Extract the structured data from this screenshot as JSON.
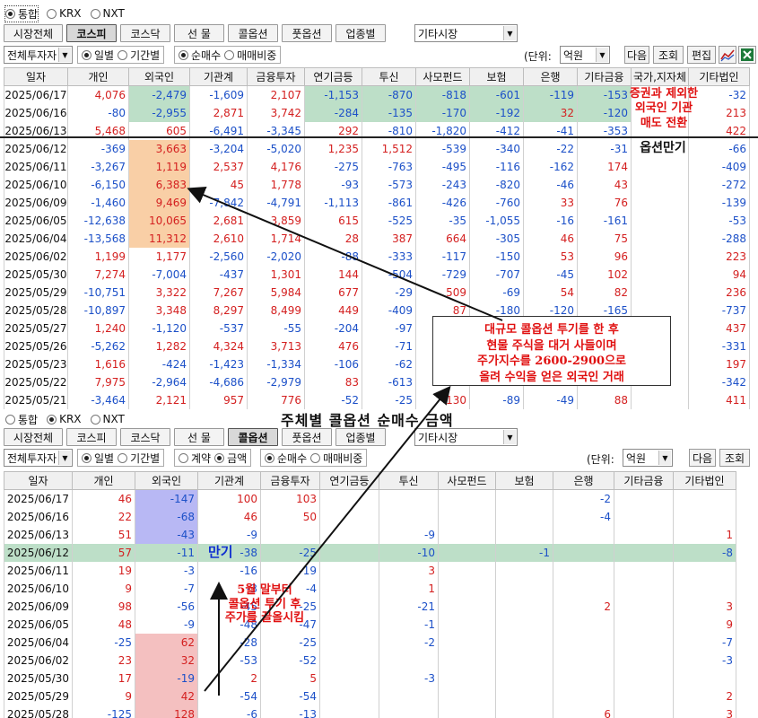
{
  "top": {
    "radios": [
      {
        "label": "통합",
        "checked": true
      },
      {
        "label": "KRX",
        "checked": false
      },
      {
        "label": "NXT",
        "checked": false
      }
    ],
    "tabs": [
      "시장전체",
      "코스피",
      "코스닥",
      "선 물",
      "콜옵션",
      "풋옵션",
      "업종별"
    ],
    "selected_tab": "코스피",
    "market_select": "기타시장",
    "investor_select": "전체투자자",
    "period_options": [
      {
        "label": "일별",
        "checked": true
      },
      {
        "label": "기간별",
        "checked": false
      }
    ],
    "mode_options": [
      {
        "label": "순매수",
        "checked": true
      },
      {
        "label": "매매비중",
        "checked": false
      }
    ],
    "unit_label": "(단위:",
    "unit_select": "억원",
    "buttons": {
      "next": "다음",
      "query": "조회",
      "edit": "편집"
    },
    "icons": [
      "chart-icon",
      "excel-icon"
    ],
    "columns": [
      "일자",
      "개인",
      "외국인",
      "기관계",
      "금융투자",
      "연기금등",
      "투신",
      "사모펀드",
      "보험",
      "은행",
      "기타금융",
      "국가,지자체",
      "기타법인"
    ],
    "rows": [
      [
        "2025/06/17",
        "4,076",
        "-2,479",
        "-1,609",
        "2,107",
        "-1,153",
        "-870",
        "-818",
        "-601",
        "-119",
        "-153",
        "",
        "-32"
      ],
      [
        "2025/06/16",
        "-80",
        "-2,955",
        "2,871",
        "3,742",
        "-284",
        "-135",
        "-170",
        "-192",
        "32",
        "-120",
        "",
        "213"
      ],
      [
        "2025/06/13",
        "5,468",
        "605",
        "-6,491",
        "-3,345",
        "292",
        "-810",
        "-1,820",
        "-412",
        "-41",
        "-353",
        "",
        "422"
      ],
      [
        "2025/06/12",
        "-369",
        "3,663",
        "-3,204",
        "-5,020",
        "1,235",
        "1,512",
        "-539",
        "-340",
        "-22",
        "-31",
        "",
        "-66"
      ],
      [
        "2025/06/11",
        "-3,267",
        "1,119",
        "2,537",
        "4,176",
        "-275",
        "-763",
        "-495",
        "-116",
        "-162",
        "174",
        "",
        "-409"
      ],
      [
        "2025/06/10",
        "-6,150",
        "6,383",
        "45",
        "1,778",
        "-93",
        "-573",
        "-243",
        "-820",
        "-46",
        "43",
        "",
        "-272"
      ],
      [
        "2025/06/09",
        "-1,460",
        "9,469",
        "-7,842",
        "-4,791",
        "-1,113",
        "-861",
        "-426",
        "-760",
        "33",
        "76",
        "",
        "-139"
      ],
      [
        "2025/06/05",
        "-12,638",
        "10,065",
        "2,681",
        "3,859",
        "615",
        "-525",
        "-35",
        "-1,055",
        "-16",
        "-161",
        "",
        "-53"
      ],
      [
        "2025/06/04",
        "-13,568",
        "11,312",
        "2,610",
        "1,714",
        "28",
        "387",
        "664",
        "-305",
        "46",
        "75",
        "",
        "-288"
      ],
      [
        "2025/06/02",
        "1,199",
        "1,177",
        "-2,560",
        "-2,020",
        "-88",
        "-333",
        "-117",
        "-150",
        "53",
        "96",
        "",
        "223"
      ],
      [
        "2025/05/30",
        "7,274",
        "-7,004",
        "-437",
        "1,301",
        "144",
        "-504",
        "-729",
        "-707",
        "-45",
        "102",
        "",
        "94"
      ],
      [
        "2025/05/29",
        "-10,751",
        "3,322",
        "7,267",
        "5,984",
        "677",
        "-29",
        "509",
        "-69",
        "54",
        "82",
        "",
        "236"
      ],
      [
        "2025/05/28",
        "-10,897",
        "3,348",
        "8,297",
        "8,499",
        "449",
        "-409",
        "87",
        "-180",
        "-120",
        "-165",
        "",
        "-737"
      ],
      [
        "2025/05/27",
        "1,240",
        "-1,120",
        "-537",
        "-55",
        "-204",
        "-97",
        "",
        "",
        "",
        "",
        "",
        "437"
      ],
      [
        "2025/05/26",
        "-5,262",
        "1,282",
        "4,324",
        "3,713",
        "476",
        "-71",
        "",
        "",
        "",
        "",
        "",
        "-331"
      ],
      [
        "2025/05/23",
        "1,616",
        "-424",
        "-1,423",
        "-1,334",
        "-106",
        "-62",
        "",
        "",
        "",
        "",
        "",
        "197"
      ],
      [
        "2025/05/22",
        "7,975",
        "-2,964",
        "-4,686",
        "-2,979",
        "83",
        "-613",
        "",
        "",
        "",
        "",
        "",
        "-342"
      ],
      [
        "2025/05/21",
        "-3,464",
        "2,121",
        "957",
        "776",
        "-52",
        "-25",
        "130",
        "-89",
        "-49",
        "88",
        "",
        "411"
      ]
    ]
  },
  "bottom": {
    "radios": [
      {
        "label": "통합",
        "checked": false
      },
      {
        "label": "KRX",
        "checked": true
      },
      {
        "label": "NXT",
        "checked": false
      }
    ],
    "tabs": [
      "시장전체",
      "코스피",
      "코스닥",
      "선 물",
      "콜옵션",
      "풋옵션",
      "업종별"
    ],
    "selected_tab": "콜옵션",
    "market_select": "기타시장",
    "investor_select": "전체투자자",
    "period_options": [
      {
        "label": "일별",
        "checked": true
      },
      {
        "label": "기간별",
        "checked": false
      }
    ],
    "amount_options": [
      {
        "label": "계약",
        "checked": false
      },
      {
        "label": "금액",
        "checked": true
      }
    ],
    "mode_options": [
      {
        "label": "순매수",
        "checked": true
      },
      {
        "label": "매매비중",
        "checked": false
      }
    ],
    "unit_label": "(단위:",
    "unit_select": "억원",
    "buttons": {
      "next": "다음",
      "query": "조회"
    },
    "columns": [
      "일자",
      "개인",
      "외국인",
      "기관계",
      "금융투자",
      "연기금등",
      "투신",
      "사모펀드",
      "보험",
      "은행",
      "기타금융",
      "기타법인"
    ],
    "rows": [
      [
        "2025/06/17",
        "46",
        "-147",
        "100",
        "103",
        "",
        "",
        "",
        "",
        "-2",
        "",
        ""
      ],
      [
        "2025/06/16",
        "22",
        "-68",
        "46",
        "50",
        "",
        "",
        "",
        "",
        "-4",
        "",
        ""
      ],
      [
        "2025/06/13",
        "51",
        "-43",
        "-9",
        "",
        "",
        "-9",
        "",
        "",
        "",
        "",
        "1"
      ],
      [
        "2025/06/12",
        "57",
        "-11",
        "-38",
        "-25",
        "",
        "-10",
        "",
        "-1",
        "",
        "",
        "-8"
      ],
      [
        "2025/06/11",
        "19",
        "-3",
        "-16",
        "-19",
        "",
        "3",
        "",
        "",
        "",
        "",
        ""
      ],
      [
        "2025/06/10",
        "9",
        "-7",
        "-3",
        "-4",
        "",
        "1",
        "",
        "",
        "",
        "",
        ""
      ],
      [
        "2025/06/09",
        "98",
        "-56",
        "-45",
        "-25",
        "",
        "-21",
        "",
        "",
        "2",
        "",
        "3"
      ],
      [
        "2025/06/05",
        "48",
        "-9",
        "-48",
        "-47",
        "",
        "-1",
        "",
        "",
        "",
        "",
        "9"
      ],
      [
        "2025/06/04",
        "-25",
        "62",
        "-28",
        "-25",
        "",
        "-2",
        "",
        "",
        "",
        "",
        "-7"
      ],
      [
        "2025/06/02",
        "23",
        "32",
        "-53",
        "-52",
        "",
        "",
        "",
        "",
        "",
        "",
        "-3"
      ],
      [
        "2025/05/30",
        "17",
        "-19",
        "2",
        "5",
        "",
        "-3",
        "",
        "",
        "",
        "",
        ""
      ],
      [
        "2025/05/29",
        "9",
        "42",
        "-54",
        "-54",
        "",
        "",
        "",
        "",
        "",
        "",
        "2"
      ],
      [
        "2025/05/28",
        "-125",
        "128",
        "-6",
        "-13",
        "",
        "",
        "",
        "",
        "6",
        "",
        "3"
      ]
    ]
  },
  "annotations": {
    "top_note": "증권과 제외한\n외국인 기관\n매도 전환",
    "option_expiry": "옵션만기",
    "box_text": "대규모 콜옵션 투기를 한 후\n현물 주식을 대거 사들이며\n주가지수를 2600-2900으로\n올려 수익을 얻은 외국인 거래",
    "caption": "주체별 콜옵션 순매수 금액",
    "expiry_short": "만기",
    "bottom_note": "5월 말부터\n콜옵션 투기 후\n주가를 끌올시킴"
  },
  "colors": {
    "negative": "#1c50c8",
    "positive": "#d42020",
    "green_highlight": "#bddfc8",
    "orange_highlight": "#f9cfa6",
    "blue_highlight": "#b8b8f4",
    "pink_highlight": "#f4c0c0",
    "annotation": "#e01010"
  }
}
